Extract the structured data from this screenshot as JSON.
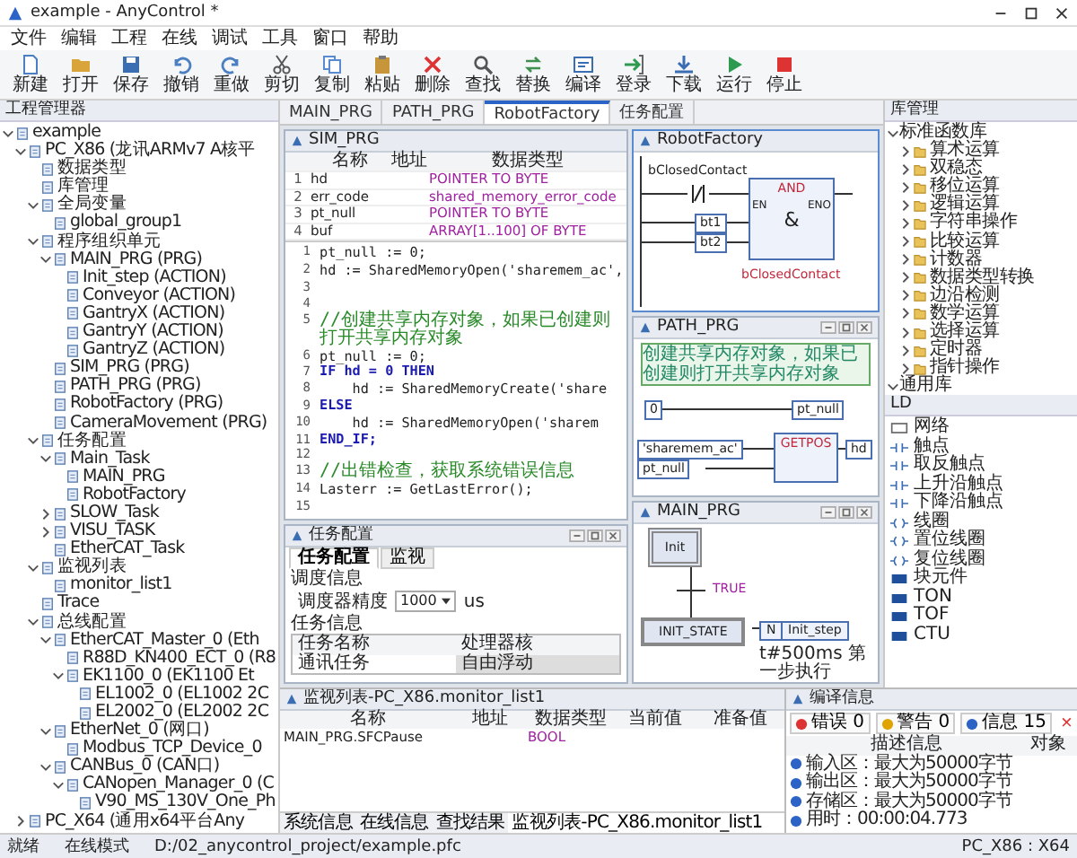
{
  "window": {
    "title": "example - AnyControl *"
  },
  "menu": [
    "文件",
    "编辑",
    "工程",
    "在线",
    "调试",
    "工具",
    "窗口",
    "帮助"
  ],
  "toolbar": [
    {
      "kind": "new",
      "label": "新建"
    },
    {
      "kind": "open",
      "label": "打开"
    },
    {
      "kind": "save",
      "label": "保存"
    },
    {
      "kind": "undo",
      "label": "撤销"
    },
    {
      "kind": "redo",
      "label": "重做"
    },
    {
      "kind": "cut",
      "label": "剪切"
    },
    {
      "kind": "copy",
      "label": "复制"
    },
    {
      "kind": "paste",
      "label": "粘贴"
    },
    {
      "kind": "delete",
      "label": "删除"
    },
    {
      "kind": "search",
      "label": "查找"
    },
    {
      "kind": "replace",
      "label": "替换"
    },
    {
      "kind": "build",
      "label": "编译"
    },
    {
      "kind": "login",
      "label": "登录"
    },
    {
      "kind": "download",
      "label": "下载"
    },
    {
      "kind": "run",
      "label": "运行"
    },
    {
      "kind": "stop",
      "label": "停止"
    }
  ],
  "project_tree": {
    "title": "工程管理器",
    "items": [
      {
        "label": "example",
        "expanded": true,
        "children": [
          {
            "label": "PC_X86 (龙讯ARMv7 A核平",
            "expanded": true,
            "children": [
              {
                "label": "数据类型"
              },
              {
                "label": "库管理"
              },
              {
                "label": "全局变量",
                "expanded": true,
                "children": [
                  {
                    "label": "global_group1"
                  }
                ]
              },
              {
                "label": "程序组织单元",
                "expanded": true,
                "children": [
                  {
                    "label": "MAIN_PRG (PRG)",
                    "expanded": true,
                    "children": [
                      {
                        "label": "Init_step (ACTION)"
                      },
                      {
                        "label": "Conveyor (ACTION)"
                      },
                      {
                        "label": "GantryX (ACTION)"
                      },
                      {
                        "label": "GantryY (ACTION)"
                      },
                      {
                        "label": "GantryZ (ACTION)"
                      }
                    ]
                  },
                  {
                    "label": "SIM_PRG (PRG)"
                  },
                  {
                    "label": "PATH_PRG (PRG)"
                  },
                  {
                    "label": "RobotFactory (PRG)"
                  },
                  {
                    "label": "CameraMovement (PRG)"
                  }
                ]
              },
              {
                "label": "任务配置",
                "expanded": true,
                "children": [
                  {
                    "label": "Main_Task",
                    "expanded": true,
                    "children": [
                      {
                        "label": "MAIN_PRG"
                      },
                      {
                        "label": "RobotFactory"
                      }
                    ]
                  },
                  {
                    "label": "SLOW_Task",
                    "expanded": false
                  },
                  {
                    "label": "VISU_TASK",
                    "expanded": false
                  },
                  {
                    "label": "EtherCAT_Task"
                  }
                ]
              },
              {
                "label": "监视列表",
                "expanded": true,
                "children": [
                  {
                    "label": "monitor_list1"
                  }
                ]
              },
              {
                "label": "Trace"
              },
              {
                "label": "总线配置",
                "expanded": true,
                "children": [
                  {
                    "label": "EtherCAT_Master_0 (Eth",
                    "expanded": true,
                    "children": [
                      {
                        "label": "R88D_KN400_ECT_0 (R8"
                      },
                      {
                        "label": "EK1100_0 (EK1100 Et",
                        "expanded": true,
                        "children": [
                          {
                            "label": "EL1002_0 (EL1002 2C"
                          },
                          {
                            "label": "EL2002_0 (EL2002 2C"
                          }
                        ]
                      }
                    ]
                  },
                  {
                    "label": "EtherNet_0 (网口)",
                    "expanded": true,
                    "children": [
                      {
                        "label": "Modbus_TCP_Device_0"
                      }
                    ]
                  },
                  {
                    "label": "CANBus_0 (CAN口)",
                    "expanded": true,
                    "children": [
                      {
                        "label": "CANopen_Manager_0 (C",
                        "expanded": true,
                        "children": [
                          {
                            "label": "V90_MS_130V_One_Ph"
                          }
                        ]
                      }
                    ]
                  }
                ]
              }
            ]
          },
          {
            "label": "PC_X64 (通用x64平台Any",
            "expanded": false
          }
        ]
      }
    ]
  },
  "editor_tabs": [
    {
      "label": "MAIN_PRG",
      "selected": false
    },
    {
      "label": "PATH_PRG",
      "selected": false
    },
    {
      "label": "RobotFactory",
      "selected": true
    },
    {
      "label": "任务配置",
      "selected": false
    }
  ],
  "sim_prg": {
    "title": "SIM_PRG",
    "columns": [
      "名称",
      "地址",
      "数据类型"
    ],
    "variables": [
      {
        "no": "1",
        "name": "hd",
        "type": "POINTER TO BYTE"
      },
      {
        "no": "2",
        "name": "err_code",
        "type": "shared_memory_error_code"
      },
      {
        "no": "3",
        "name": "pt_null",
        "type": "POINTER TO BYTE"
      },
      {
        "no": "4",
        "name": "buf",
        "type": "ARRAY[1..100] OF BYTE"
      }
    ],
    "code": [
      {
        "no": "1",
        "kind": "code",
        "text": "pt_null := 0;"
      },
      {
        "no": "2",
        "kind": "code",
        "text": "hd := SharedMemoryOpen('sharemem_ac',"
      },
      {
        "no": "3",
        "kind": "blank"
      },
      {
        "no": "4",
        "kind": "blank"
      },
      {
        "no": "5",
        "kind": "comment",
        "text": "//创建共享内存对象，如果已创建则打开共享内存对象"
      },
      {
        "no": "6",
        "kind": "code",
        "text": "pt_null := 0;"
      },
      {
        "no": "7",
        "kind": "keyword",
        "text": "IF hd = 0 THEN"
      },
      {
        "no": "8",
        "kind": "code",
        "text": "    hd := SharedMemoryCreate('share"
      },
      {
        "no": "9",
        "kind": "keyword",
        "text": "ELSE"
      },
      {
        "no": "10",
        "kind": "code",
        "text": "    hd := SharedMemoryOpen('sharem"
      },
      {
        "no": "11",
        "kind": "keyword",
        "text": "END_IF;"
      },
      {
        "no": "12",
        "kind": "blank"
      },
      {
        "no": "13",
        "kind": "comment",
        "text": "//出错检查，获取系统错误信息"
      },
      {
        "no": "14",
        "kind": "code",
        "text": "Lasterr := GetLastError();"
      },
      {
        "no": "15",
        "kind": "blank"
      }
    ]
  },
  "robot_factory": {
    "title": "RobotFactory",
    "contact": "bClosedContact",
    "inputs": [
      "bt1",
      "bt2"
    ],
    "block": "AND",
    "block_symbol": "&",
    "en": "EN",
    "eno": "ENO",
    "output": "bClosedContact"
  },
  "path_prg": {
    "title": "PATH_PRG",
    "comment": "创建共享内存对象，如果已创建则打开共享内存对象",
    "constant": "0",
    "target": "pt_null",
    "block": "GETPOS",
    "arg1": "'sharemem_ac'",
    "arg2": "pt_null",
    "result": "hd"
  },
  "main_prg": {
    "title": "MAIN_PRG",
    "init_step": "Init",
    "transition": "TRUE",
    "step": "INIT_STATE",
    "qualifier": "N",
    "action": "Init_step",
    "note": "t#500ms 第一步执行"
  },
  "task_config": {
    "title": "任务配置",
    "tabs": [
      {
        "label": "任务配置",
        "selected": true
      },
      {
        "label": "监视",
        "selected": false
      }
    ],
    "schedule_title": "调度信息",
    "precision_label": "调度器精度",
    "precision_value": "1000",
    "precision_unit": "us",
    "task_title": "任务信息",
    "columns": [
      "任务名称",
      "处理器核"
    ],
    "rows": [
      {
        "name": "通讯任务",
        "core": "自由浮动"
      }
    ]
  },
  "library": {
    "title": "库管理",
    "items": [
      {
        "label": "标准函数库",
        "expanded": true,
        "children": [
          {
            "label": "算术运算",
            "expanded": false
          },
          {
            "label": "双稳态",
            "expanded": false
          },
          {
            "label": "移位运算",
            "expanded": false
          },
          {
            "label": "逻辑运算",
            "expanded": false
          },
          {
            "label": "字符串操作",
            "expanded": false
          },
          {
            "label": "比较运算",
            "expanded": false
          },
          {
            "label": "计数器",
            "expanded": false
          },
          {
            "label": "数据类型转换",
            "expanded": false
          },
          {
            "label": "边沿检测",
            "expanded": false
          },
          {
            "label": "数学运算",
            "expanded": false
          },
          {
            "label": "选择运算",
            "expanded": false
          },
          {
            "label": "定时器",
            "expanded": false
          },
          {
            "label": "指针操作",
            "expanded": false
          }
        ]
      },
      {
        "label": "通用库",
        "expanded": true
      }
    ]
  },
  "ld_toolbox": {
    "title": "LD",
    "items": [
      {
        "kind": "network",
        "label": "网络"
      },
      {
        "kind": "contact",
        "label": "触点"
      },
      {
        "kind": "contact",
        "label": "取反触点"
      },
      {
        "kind": "contact",
        "label": "上升沿触点"
      },
      {
        "kind": "contact",
        "label": "下降沿触点"
      },
      {
        "kind": "coil",
        "label": "线圈"
      },
      {
        "kind": "coil",
        "label": "置位线圈"
      },
      {
        "kind": "coil",
        "label": "复位线圈"
      },
      {
        "kind": "block",
        "label": "块元件"
      },
      {
        "kind": "block",
        "label": "TON"
      },
      {
        "kind": "block",
        "label": "TOF"
      },
      {
        "kind": "block",
        "label": "CTU"
      }
    ]
  },
  "monitor": {
    "title": "监视列表-PC_X86.monitor_list1",
    "columns": [
      "名称",
      "地址",
      "数据类型",
      "当前值",
      "准备值"
    ],
    "rows": [
      {
        "name": "MAIN_PRG.SFCPause",
        "type": "BOOL"
      }
    ]
  },
  "bottom_tabs": [
    {
      "label": "系统信息",
      "selected": false
    },
    {
      "label": "在线信息",
      "selected": false
    },
    {
      "label": "查找结果",
      "selected": false
    },
    {
      "label": "监视列表-PC_X86.monitor_list1",
      "selected": true
    }
  ],
  "compile": {
    "title": "编译信息",
    "filters": [
      {
        "kind": "error",
        "label": "错误 0"
      },
      {
        "kind": "warning",
        "label": "警告 0"
      },
      {
        "kind": "info",
        "label": "信息 15"
      }
    ],
    "clear": "×",
    "columns": [
      "描述信息",
      "对象"
    ],
    "rows": [
      {
        "text": "输入区：最大为50000字节"
      },
      {
        "text": "输出区：最大为50000字节"
      },
      {
        "text": "存储区：最大为50000字节"
      },
      {
        "text": "用时：00:00:04.773"
      }
    ]
  },
  "status_bar": {
    "state": "就绪",
    "mode": "在线模式",
    "path": "D:/02_anycontrol_project/example.pfc",
    "target": "PC_X86 : X64"
  }
}
